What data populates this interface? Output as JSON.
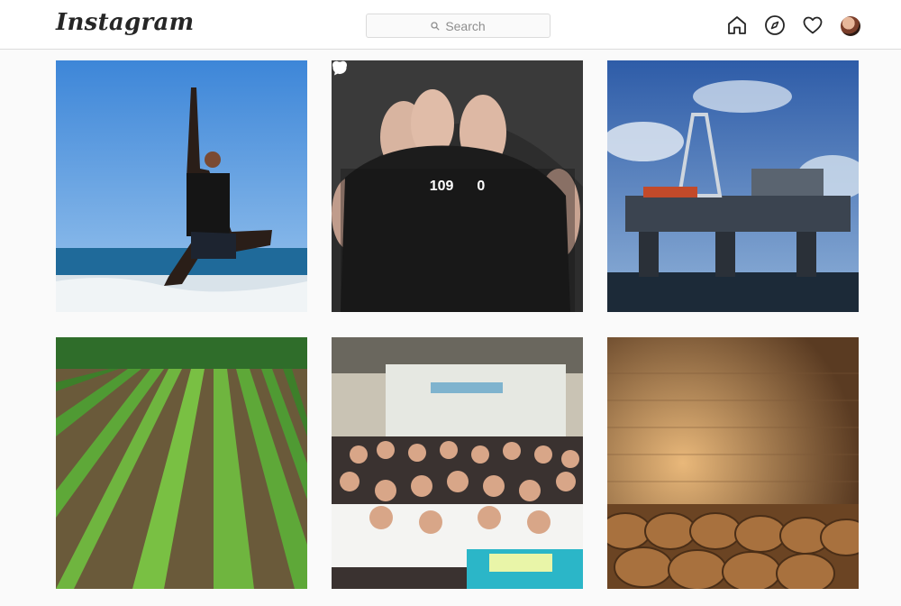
{
  "header": {
    "logo_text": "Instagram",
    "search_placeholder": "Search",
    "nav_icons": [
      "home-icon",
      "explore-compass-icon",
      "activity-heart-icon",
      "profile-avatar"
    ]
  },
  "colors": {
    "header_bg": "#ffffff",
    "border": "#dbdbdb",
    "page_bg": "#fafafa",
    "text_secondary": "#8e8e8e"
  },
  "grid": {
    "posts": [
      {
        "id": "post-yoga-beach"
      },
      {
        "id": "post-soil-hands",
        "hover": {
          "likes": "109",
          "comments": "0"
        }
      },
      {
        "id": "post-oil-rig"
      },
      {
        "id": "post-vineyard"
      },
      {
        "id": "post-group-photo"
      },
      {
        "id": "post-wine-cellar"
      }
    ]
  }
}
